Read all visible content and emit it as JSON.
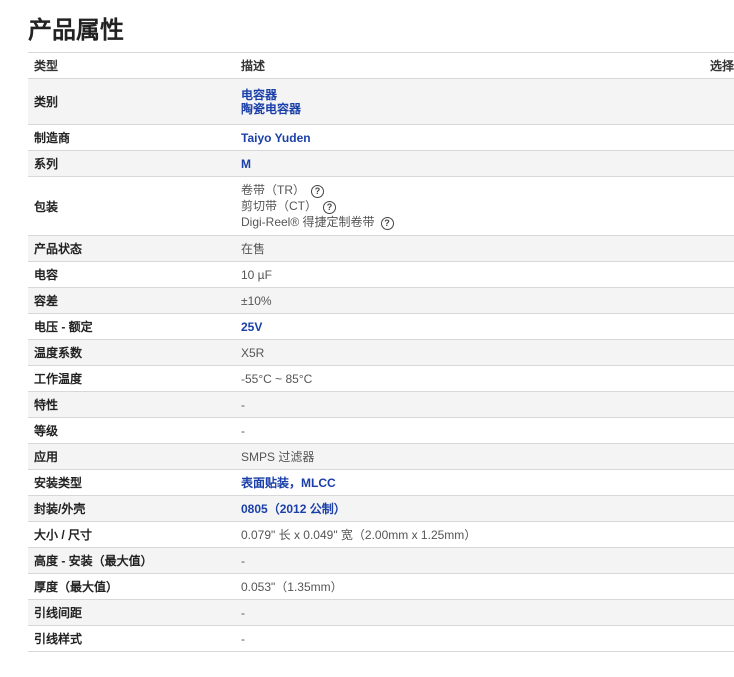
{
  "page": {
    "title": "产品属性"
  },
  "table": {
    "headers": {
      "type": "类型",
      "description": "描述",
      "select": "选择"
    },
    "rows": [
      {
        "type": "类别",
        "links": [
          "电容器",
          "陶瓷电容器"
        ]
      },
      {
        "type": "制造商",
        "link": "Taiyo Yuden"
      },
      {
        "type": "系列",
        "link": "M"
      },
      {
        "type": "包装",
        "packaging": [
          "卷带（TR）",
          "剪切带（CT）",
          "Digi-Reel® 得捷定制卷带"
        ]
      },
      {
        "type": "产品状态",
        "value": "在售"
      },
      {
        "type": "电容",
        "value": "10 µF"
      },
      {
        "type": "容差",
        "value": "±10%"
      },
      {
        "type": "电压 - 额定",
        "link": "25V"
      },
      {
        "type": "温度系数",
        "value": "X5R"
      },
      {
        "type": "工作温度",
        "value": "-55°C ~ 85°C"
      },
      {
        "type": "特性",
        "value": "-"
      },
      {
        "type": "等级",
        "value": "-"
      },
      {
        "type": "应用",
        "value": "SMPS 过滤器"
      },
      {
        "type": "安装类型",
        "link": "表面贴装，MLCC"
      },
      {
        "type": "封装/外壳",
        "link": "0805（2012 公制）"
      },
      {
        "type": "大小 / 尺寸",
        "value": "0.079\" 长 x 0.049\" 宽（2.00mm x 1.25mm）"
      },
      {
        "type": "高度 - 安装（最大值）",
        "value": "-"
      },
      {
        "type": "厚度（最大值）",
        "value": "0.053\"（1.35mm）"
      },
      {
        "type": "引线间距",
        "value": "-"
      },
      {
        "type": "引线样式",
        "value": "-"
      }
    ]
  },
  "icons": {
    "help": "help-circle-icon",
    "help_glyph": "?"
  },
  "colors": {
    "link": "#1a3fa8",
    "row_alt": "#f4f4f4",
    "border": "#d8d8d8"
  }
}
